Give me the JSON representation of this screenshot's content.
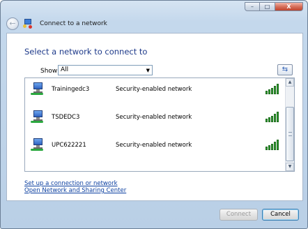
{
  "window": {
    "title": "Connect to a network",
    "controls": {
      "minimize": "–",
      "maximize": "□",
      "close": "X"
    }
  },
  "main": {
    "heading": "Select a network to connect to",
    "show_label": "Show",
    "show_value": "All",
    "refresh_icon": "refresh-icon"
  },
  "networks": [
    {
      "name": "Trainingedc3",
      "security": "Security-enabled network",
      "signal_bars": 5
    },
    {
      "name": "TSDEDC3",
      "security": "Security-enabled network",
      "signal_bars": 5
    },
    {
      "name": "UPC622221",
      "security": "Security-enabled network",
      "signal_bars": 5
    }
  ],
  "links": {
    "setup": "Set up a connection or network",
    "sharing": "Open Network and Sharing Center"
  },
  "buttons": {
    "connect": "Connect",
    "cancel": "Cancel"
  },
  "colors": {
    "heading": "#1e3a8a",
    "link": "#0b3fa0",
    "signal": "#2f9e2f"
  }
}
